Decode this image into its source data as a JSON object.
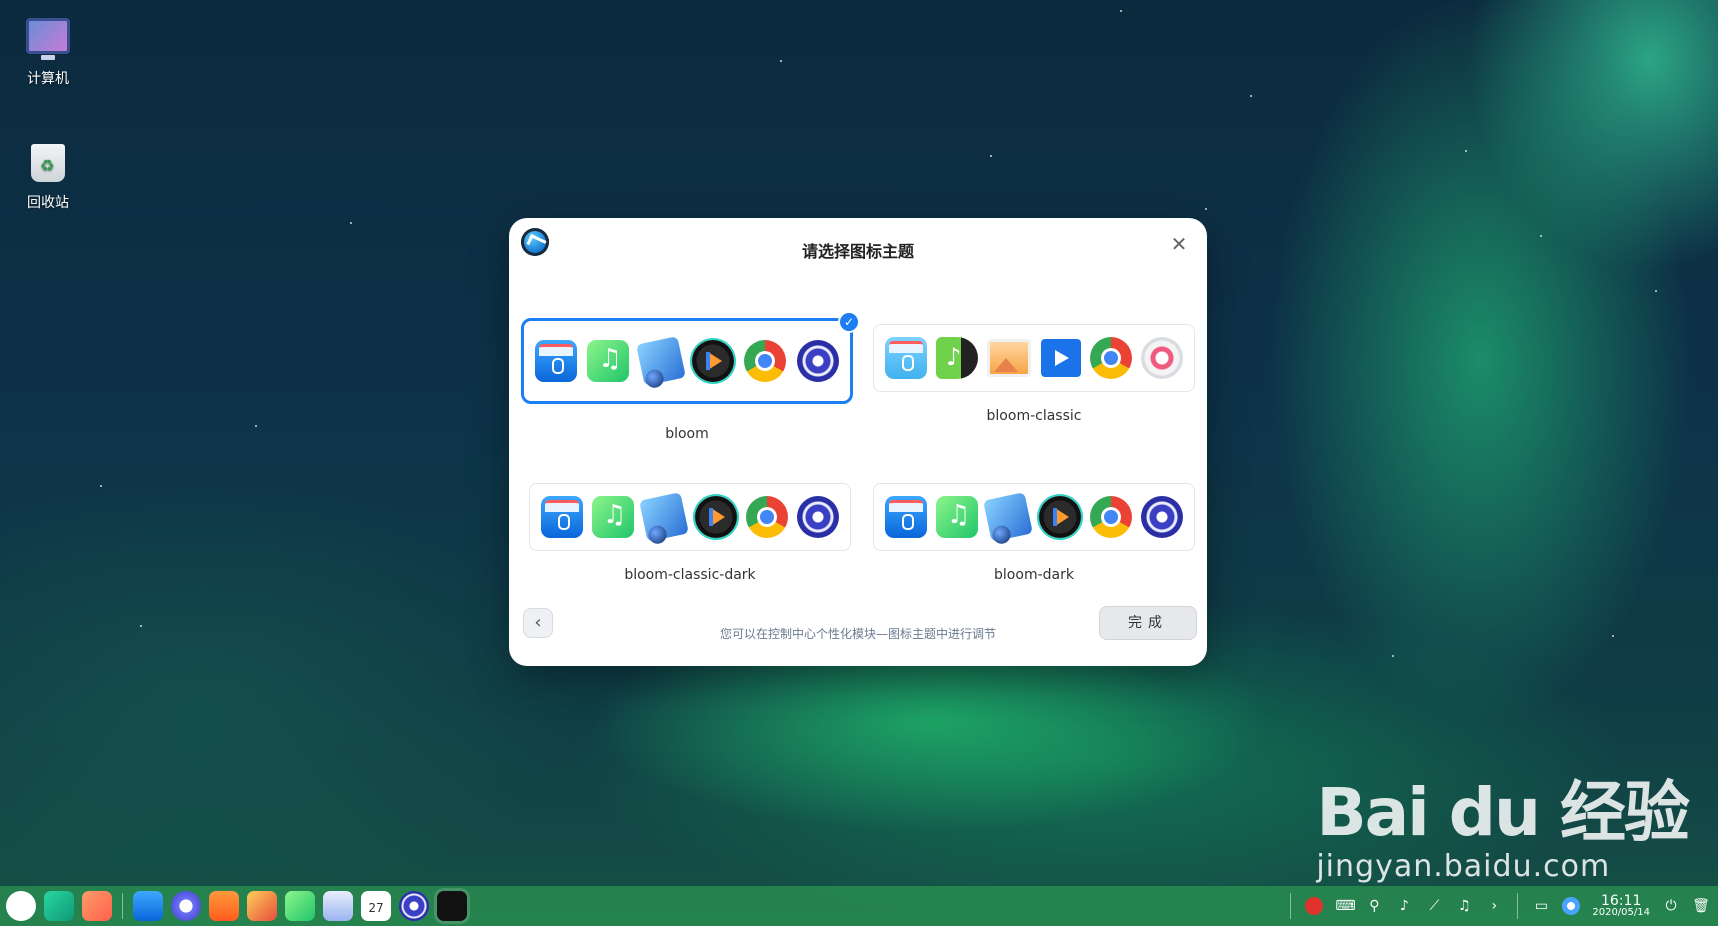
{
  "desktop": {
    "icons": [
      {
        "label": "计算机"
      },
      {
        "label": "回收站"
      }
    ]
  },
  "dialog": {
    "title": "请选择图标主题",
    "close_symbol": "✕",
    "themes": [
      {
        "name": "bloom",
        "selected": true
      },
      {
        "name": "bloom-classic",
        "selected": false
      },
      {
        "name": "bloom-classic-dark",
        "selected": false
      },
      {
        "name": "bloom-dark",
        "selected": false
      }
    ],
    "hint": "您可以在控制中心个性化模块—图标主题中进行调节",
    "back_symbol": "‹",
    "done_label": "完成"
  },
  "taskbar": {
    "clock_time": "16:11",
    "clock_date": "2020/05/14"
  },
  "watermark": {
    "main": "Bai du 经验",
    "sub": "jingyan.baidu.com"
  }
}
